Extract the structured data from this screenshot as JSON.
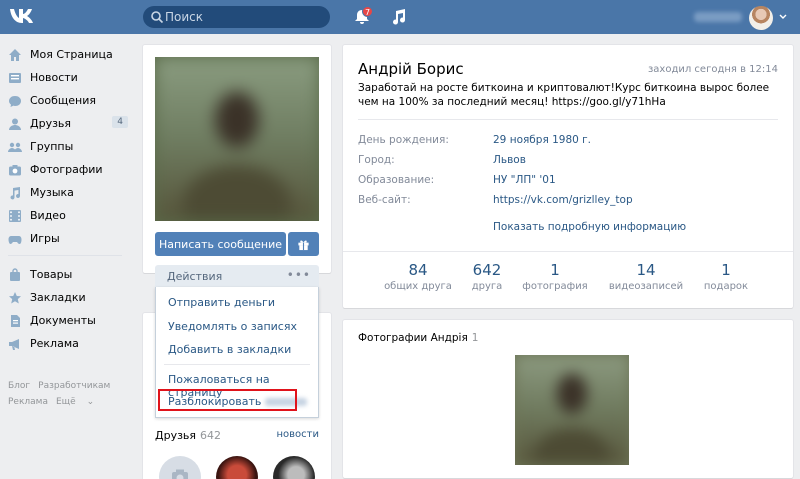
{
  "header": {
    "search_placeholder": "Поиск",
    "notifications_count": "7",
    "colors": {
      "bar": "#4a76a8",
      "search_bg": "#224b7a",
      "badge": "#e64646"
    }
  },
  "nav": {
    "items": [
      {
        "label": "Моя Страница",
        "icon": "home-icon"
      },
      {
        "label": "Новости",
        "icon": "news-icon"
      },
      {
        "label": "Сообщения",
        "icon": "messages-icon"
      },
      {
        "label": "Друзья",
        "icon": "friends-icon",
        "count": "4"
      },
      {
        "label": "Группы",
        "icon": "groups-icon"
      },
      {
        "label": "Фотографии",
        "icon": "camera-icon"
      },
      {
        "label": "Музыка",
        "icon": "music-icon"
      },
      {
        "label": "Видео",
        "icon": "video-icon"
      },
      {
        "label": "Игры",
        "icon": "gamepad-icon"
      }
    ],
    "items2": [
      {
        "label": "Товары",
        "icon": "bag-icon"
      },
      {
        "label": "Закладки",
        "icon": "star-icon"
      },
      {
        "label": "Документы",
        "icon": "document-icon"
      },
      {
        "label": "Реклама",
        "icon": "megaphone-icon"
      }
    ],
    "footer": {
      "blog": "Блог",
      "developers": "Разработчикам",
      "ads": "Реклама",
      "more": "Ещё"
    }
  },
  "profile": {
    "send_message": "Написать сообщение",
    "actions_label": "Действия",
    "actions_dots": "•••",
    "menu": {
      "send_money": "Отправить деньги",
      "notify_posts": "Уведомлять о записях",
      "add_bookmarks": "Добавить в закладки",
      "report": "Пожаловаться на страницу",
      "unblock": "Разблокировать"
    },
    "friends": {
      "title": "Друзья",
      "count": "642",
      "all": "новости"
    }
  },
  "info": {
    "name": "Андрій Борис",
    "last_seen": "заходил сегодня в 12:14",
    "status": "Заработай на росте биткоина и криптовалют!Курс биткоина вырос более чем на 100% за последний месяц! https://goo.gl/y71hHa",
    "rows": [
      {
        "label": "День рождения:",
        "value": "29 ноября 1980 г."
      },
      {
        "label": "Город:",
        "value": "Львов"
      },
      {
        "label": "Образование:",
        "value": "НУ \"ЛП\" '01"
      },
      {
        "label": "Веб-сайт:",
        "value": "https://vk.com/grizlley_top"
      }
    ],
    "more": "Показать подробную информацию",
    "stats": [
      {
        "num": "84",
        "label": "общих друга"
      },
      {
        "num": "642",
        "label": "друга"
      },
      {
        "num": "1",
        "label": "фотография"
      },
      {
        "num": "14",
        "label": "видеозаписей"
      },
      {
        "num": "1",
        "label": "подарок"
      }
    ]
  },
  "photos": {
    "title": "Фотографии Андрія",
    "count": "1"
  }
}
